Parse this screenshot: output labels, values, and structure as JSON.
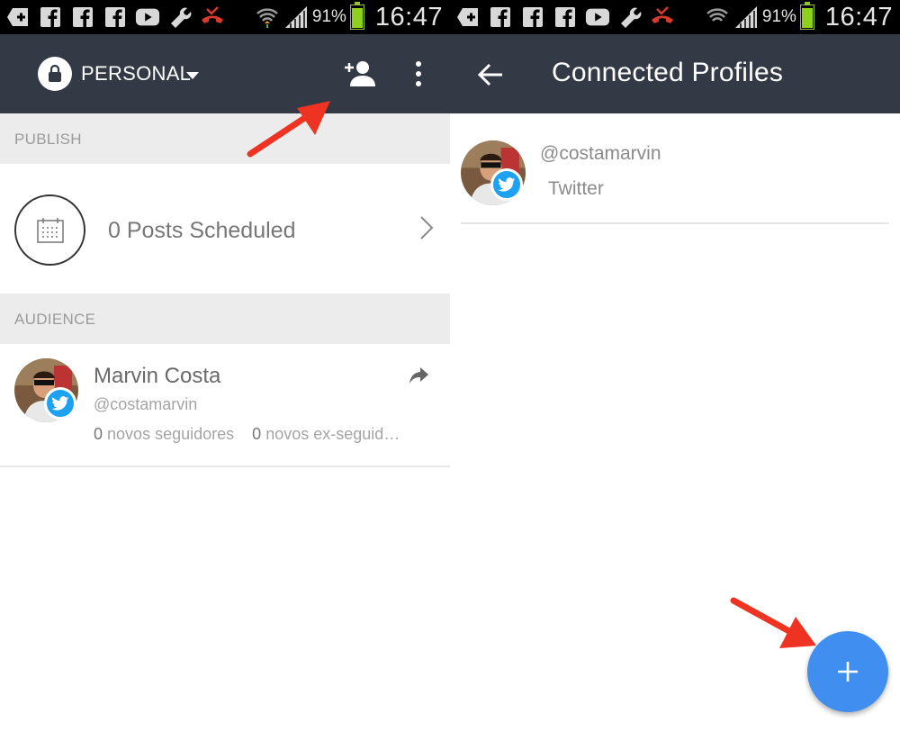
{
  "status_bar": {
    "battery_percent": "91%",
    "time": "16:47",
    "icons": [
      "add-icon",
      "facebook-icon",
      "facebook-icon",
      "facebook-icon",
      "youtube-icon",
      "wrench-icon",
      "missed-call-icon",
      "wifi-icon",
      "signal-icon",
      "battery-icon"
    ]
  },
  "left_panel": {
    "account_label": "PERSONAL",
    "publish_header": "PUBLISH",
    "posts_scheduled": "0 Posts Scheduled",
    "audience_header": "AUDIENCE",
    "profile": {
      "name": "Marvin Costa",
      "handle": "@costamarvin",
      "new_followers_count": "0",
      "new_followers_label": "novos seguidores",
      "ex_followers_count": "0",
      "ex_followers_label": "novos ex-seguid…"
    }
  },
  "right_panel": {
    "title": "Connected Profiles",
    "profiles": [
      {
        "handle": "@costamarvin",
        "network": "Twitter"
      }
    ]
  },
  "colors": {
    "appbar": "#333a45",
    "section_header": "#ececec",
    "twitter": "#1da1f2",
    "fab": "#3f8ef0",
    "annotation_arrow": "#ee3322"
  }
}
